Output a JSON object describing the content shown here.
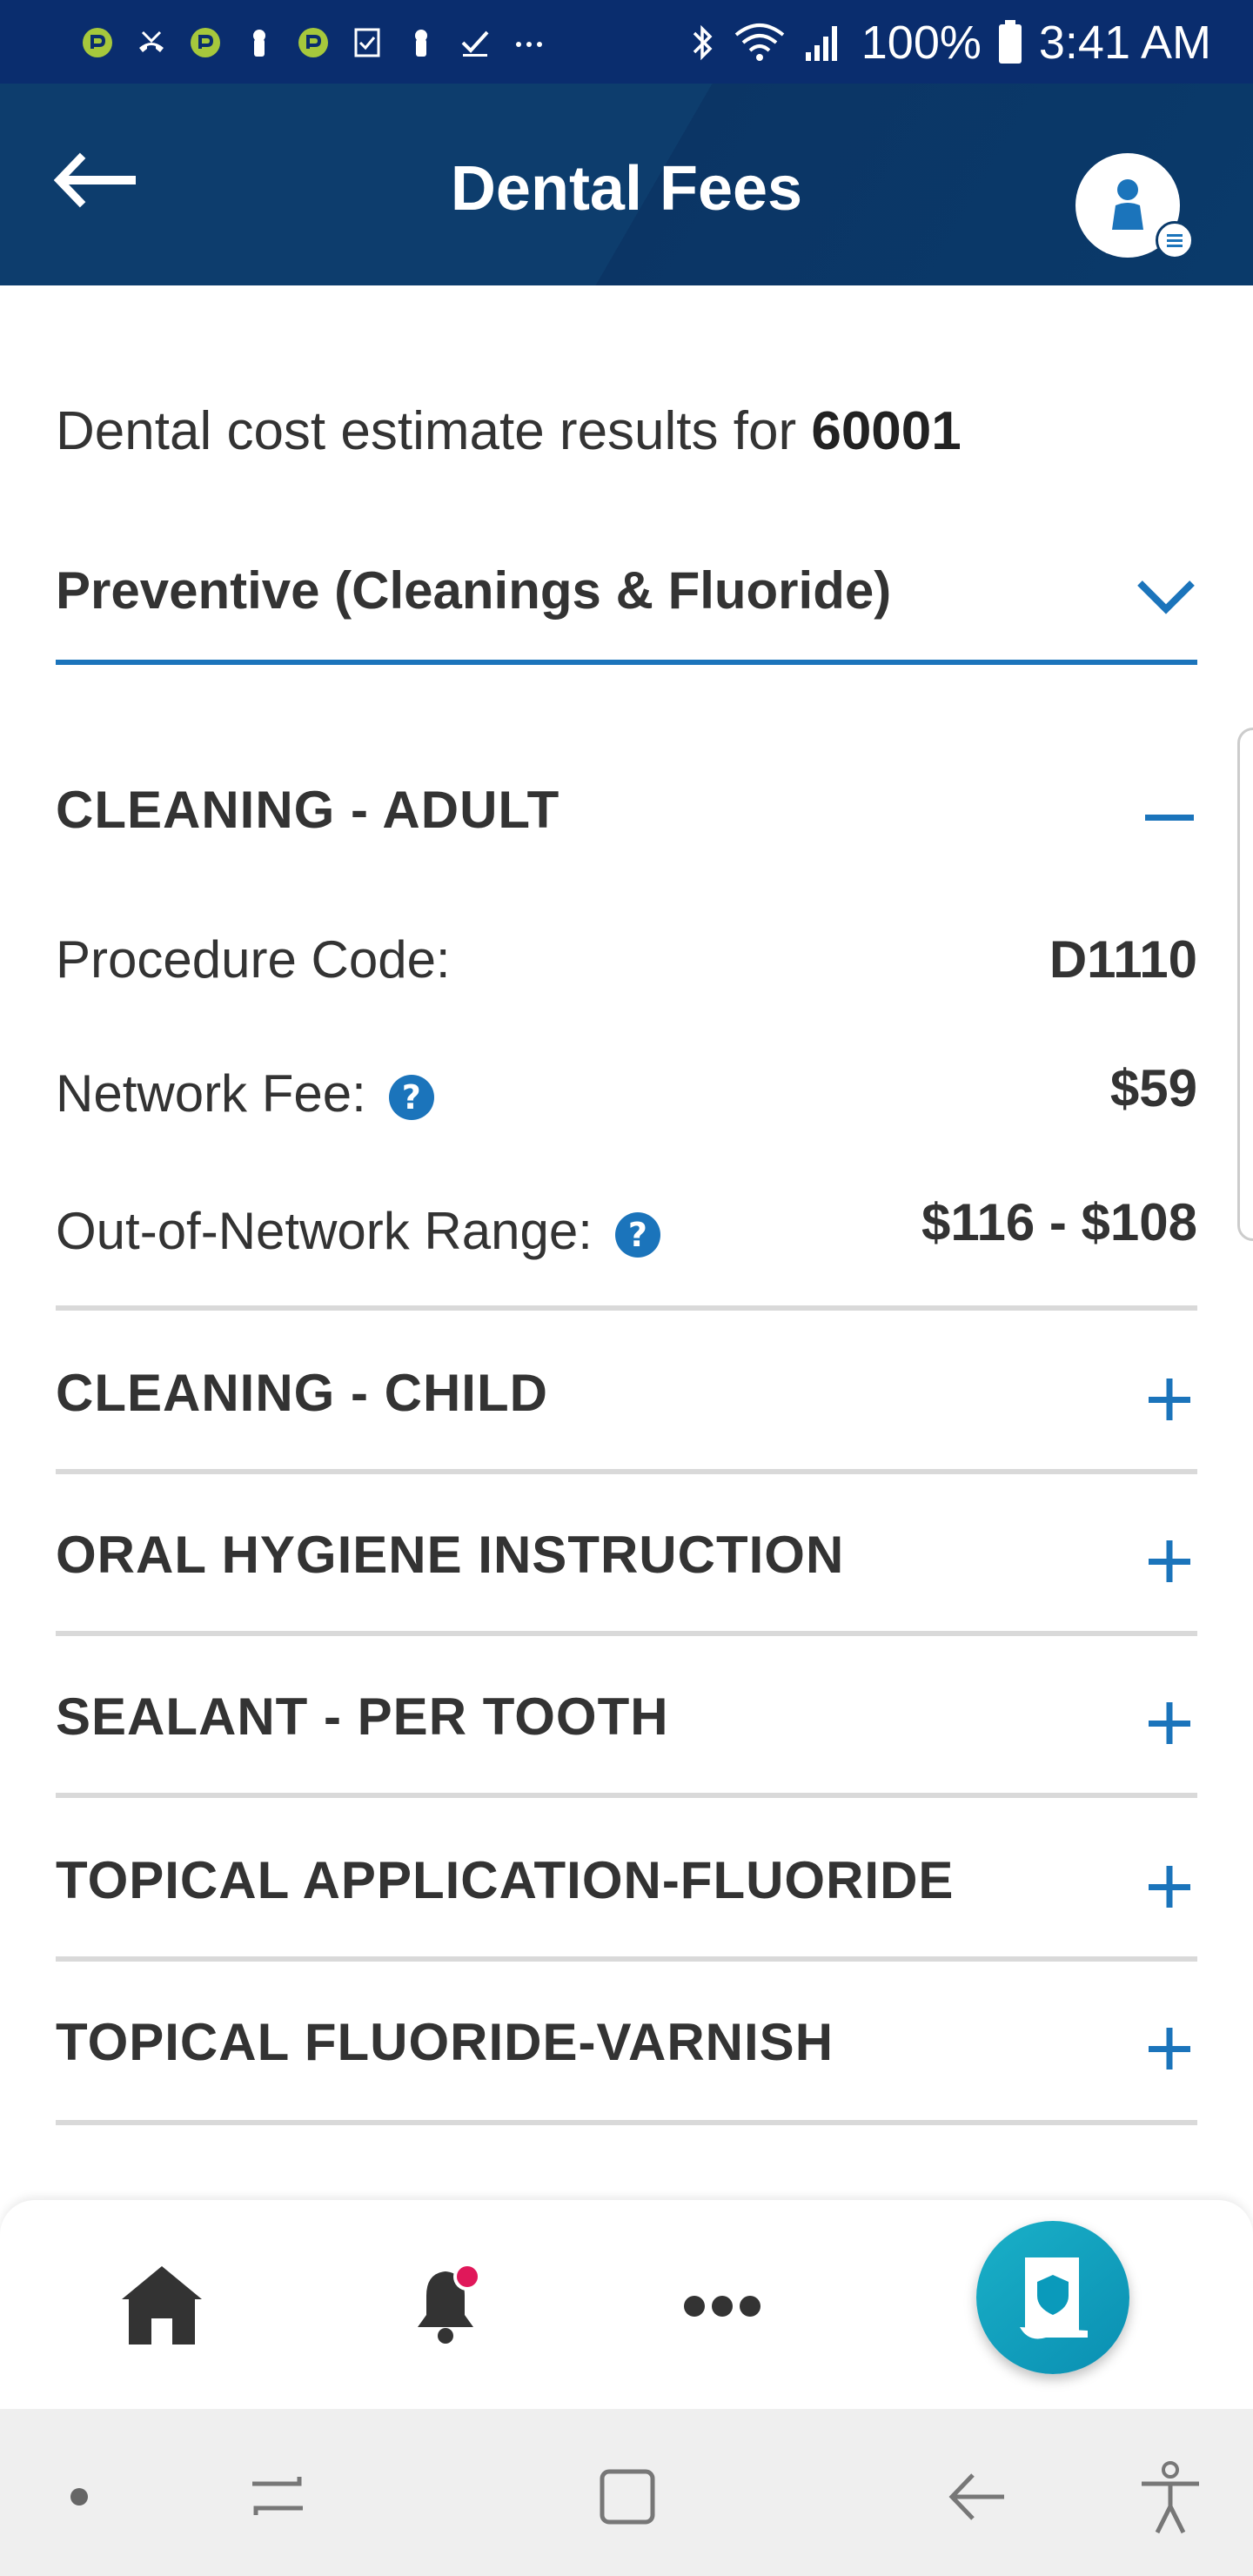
{
  "status_bar": {
    "battery": "100%",
    "time": "3:41 AM",
    "icons": [
      "app-icon",
      "missed-call-icon",
      "app-icon",
      "keyhole-icon",
      "app-icon",
      "checklist-icon",
      "keyhole-icon",
      "check-icon",
      "more-dots-icon",
      "bluetooth-icon",
      "wifi-icon",
      "signal-icon",
      "battery-icon"
    ]
  },
  "header": {
    "title": "Dental Fees",
    "back_icon": "back-arrow-icon",
    "avatar_icon": "user-profile-icon"
  },
  "intro": {
    "text": "Dental cost estimate results for",
    "zip": "60001"
  },
  "category_select": {
    "value": "Preventive (Cleanings & Fluoride)",
    "icon": "chevron-down-icon"
  },
  "procedures": {
    "expanded": {
      "title": "CLEANING - ADULT",
      "toggle": "minus-icon",
      "code_label": "Procedure Code:",
      "code_value": "D1110",
      "network_label": "Network Fee:",
      "network_value": "$59",
      "oon_label": "Out-of-Network Range:",
      "oon_value": "$116 - $108",
      "help_glyph": "?"
    },
    "collapsed": [
      {
        "title": "CLEANING - CHILD"
      },
      {
        "title": "ORAL HYGIENE INSTRUCTION"
      },
      {
        "title": "SEALANT - PER TOOTH"
      },
      {
        "title": "TOPICAL APPLICATION-FLUORIDE"
      },
      {
        "title": "TOPICAL FLUORIDE-VARNISH"
      }
    ]
  },
  "bottom_nav": {
    "items": [
      "home-icon",
      "notification-bell-icon",
      "more-icon",
      "id-card-icon"
    ],
    "notification_dot_color": "#e0185a",
    "accent_color": "#1b74bb"
  },
  "system_nav": {
    "items": [
      "dot-icon",
      "recent-apps-icon",
      "home-square-icon",
      "back-icon",
      "accessibility-icon"
    ]
  }
}
